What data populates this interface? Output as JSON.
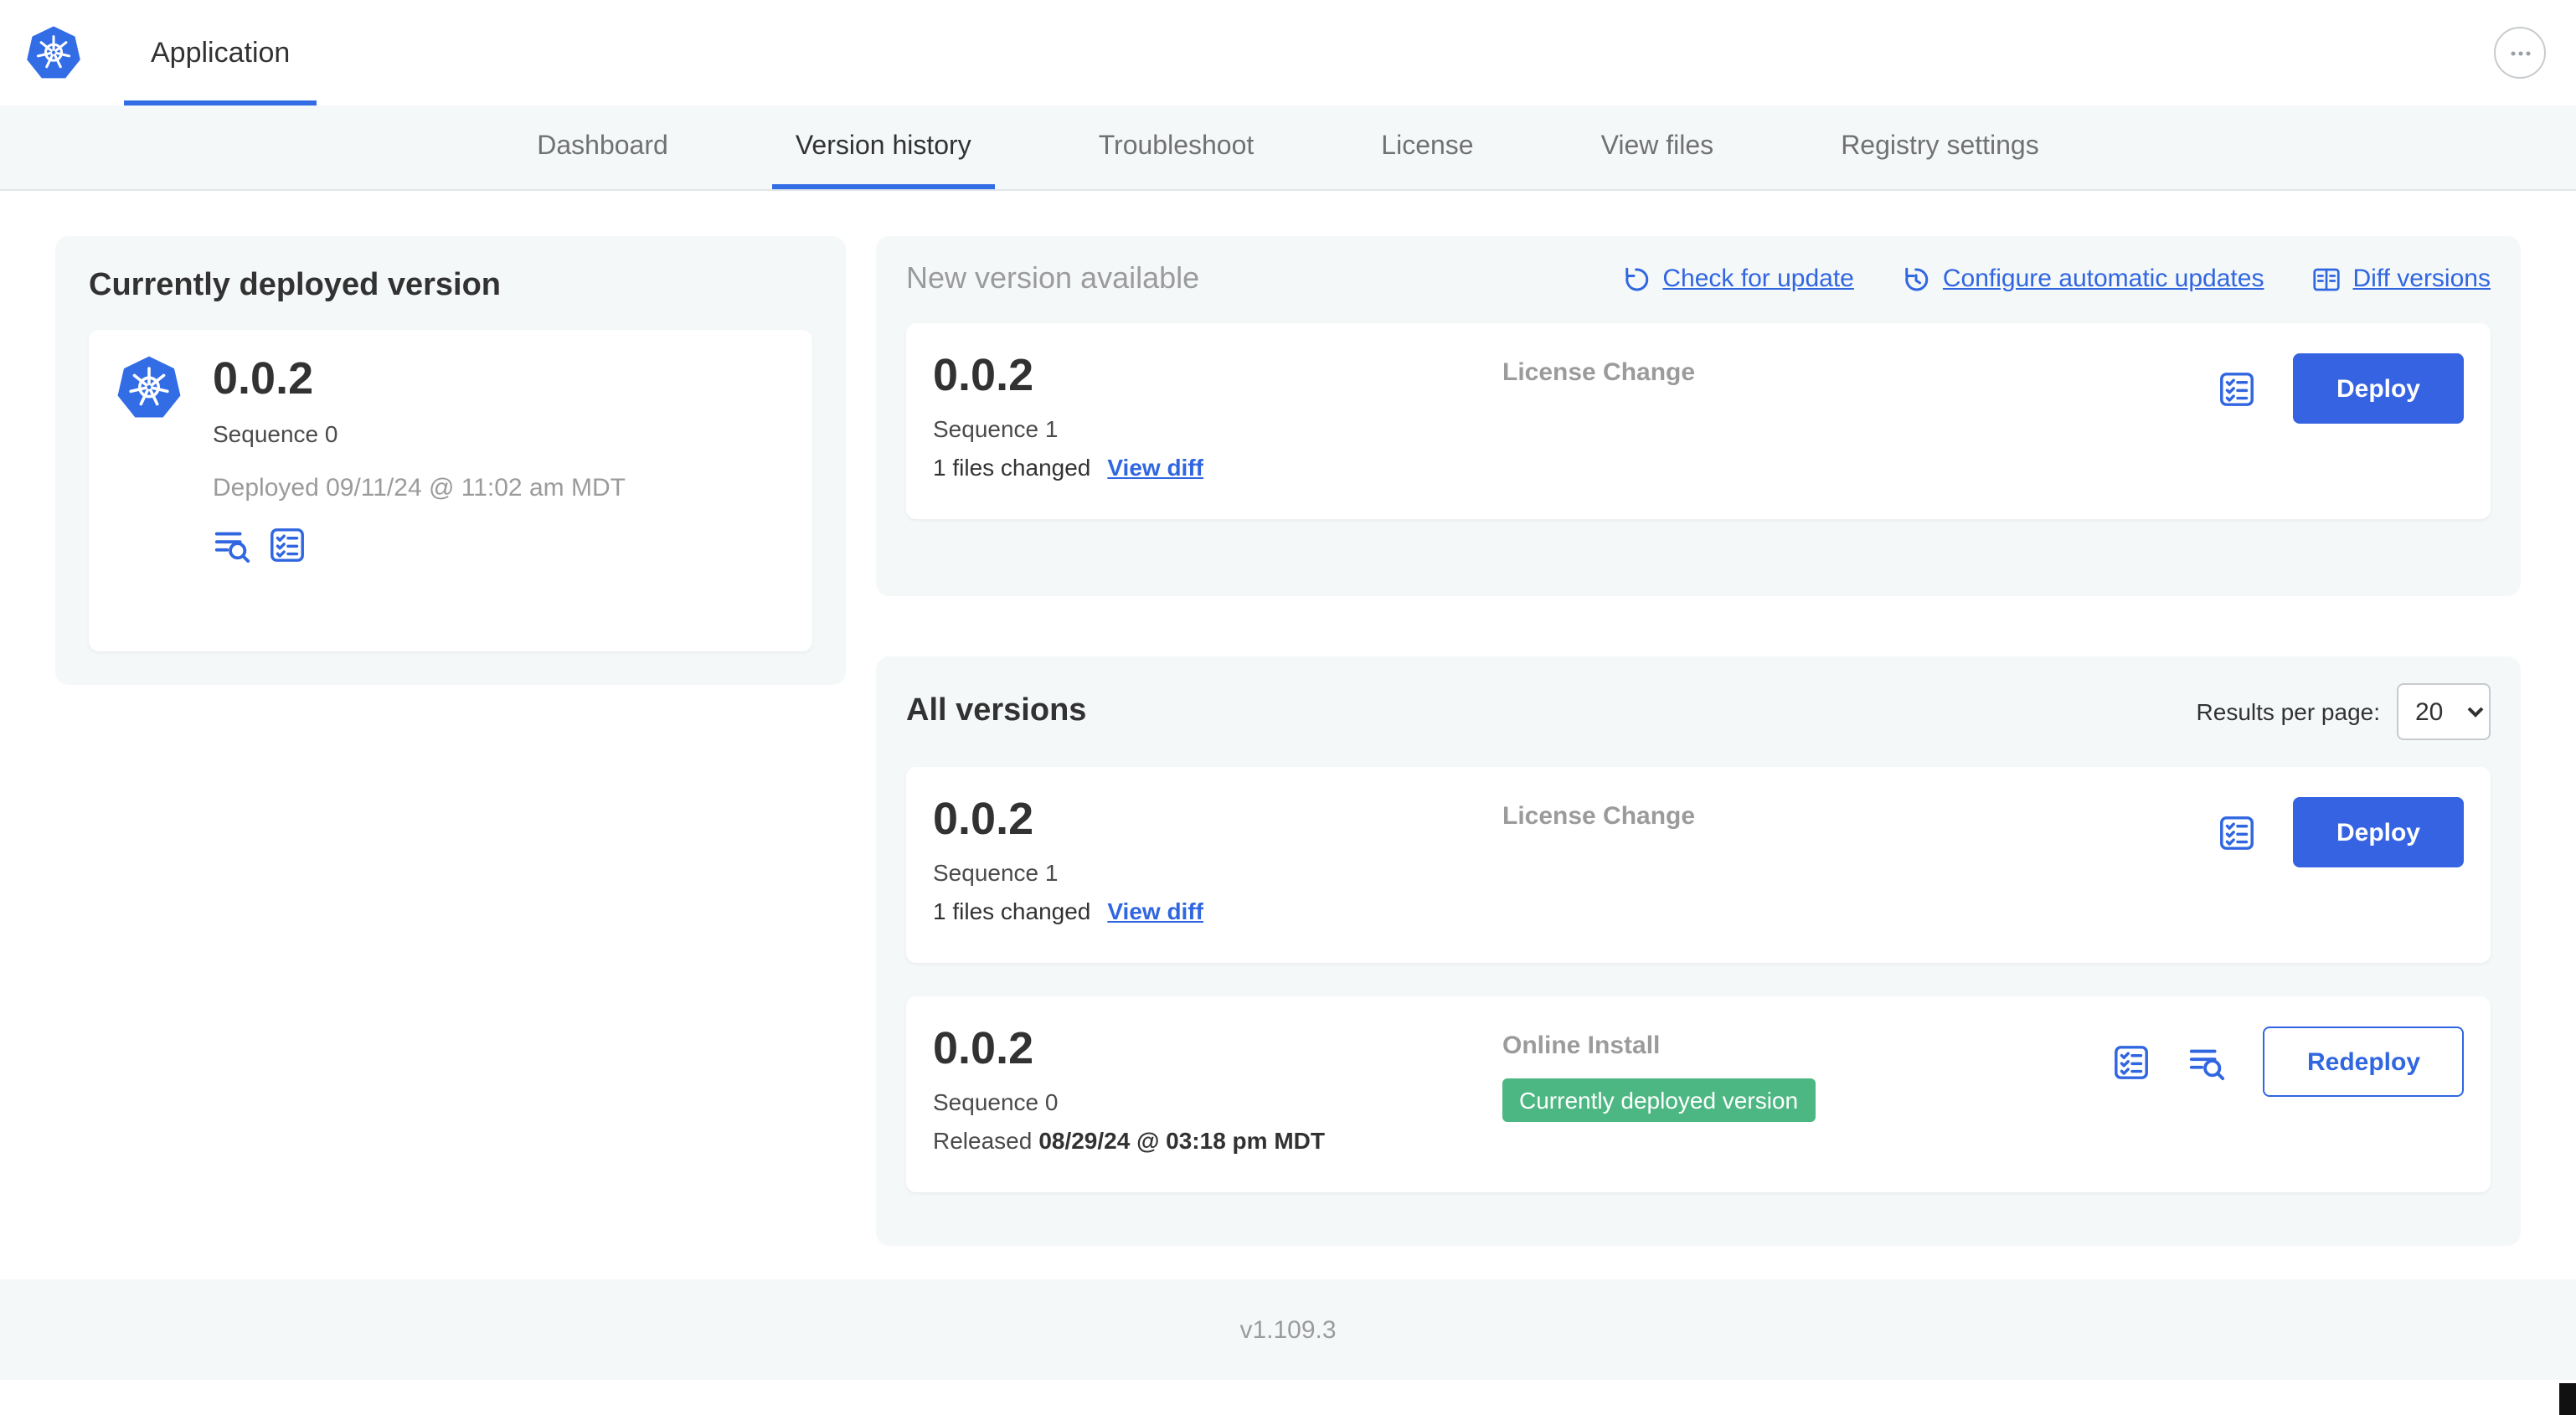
{
  "colors": {
    "accent_blue": "#326DE6",
    "button_blue": "#3563E2",
    "link_blue": "#3066E0",
    "badge_green": "#4DB783",
    "panel_gray": "#F5F8F9",
    "text_dark": "#323232",
    "text_muted": "#9B9B9B"
  },
  "header": {
    "app_tab_label": "Application",
    "more_icon": "ellipsis-icon"
  },
  "nav": {
    "active_tab": "Version history",
    "tabs": [
      {
        "label": "Dashboard"
      },
      {
        "label": "Version history"
      },
      {
        "label": "Troubleshoot"
      },
      {
        "label": "License"
      },
      {
        "label": "View files"
      },
      {
        "label": "Registry settings"
      }
    ]
  },
  "current_version": {
    "title": "Currently deployed version",
    "version": "0.0.2",
    "sequence": "Sequence 0",
    "deployed_line": "Deployed 09/11/24 @ 11:02 am MDT",
    "icons": [
      "logs-icon",
      "release-notes-icon"
    ]
  },
  "new_version": {
    "title": "New version available",
    "check_for_update": "Check for update",
    "configure_updates": "Configure automatic updates",
    "diff_versions": "Diff versions",
    "row": {
      "version": "0.0.2",
      "sequence": "Sequence 1",
      "files_changed": "1 files changed",
      "view_diff": "View diff",
      "source": "License Change",
      "deploy": "Deploy"
    }
  },
  "all_versions": {
    "title": "All versions",
    "results_per_page_label": "Results per page:",
    "results_per_page": "20",
    "rows": [
      {
        "version": "0.0.2",
        "sequence": "Sequence 1",
        "files_changed": "1 files changed",
        "view_diff": "View diff",
        "source": "License Change",
        "action": "Deploy"
      },
      {
        "version": "0.0.2",
        "sequence": "Sequence 0",
        "released_prefix": "Released",
        "released_date": "08/29/24 @ 03:18 pm MDT",
        "source": "Online Install",
        "badge": "Currently deployed version",
        "action": "Redeploy"
      }
    ]
  },
  "footer": {
    "app_version": "v1.109.3"
  }
}
